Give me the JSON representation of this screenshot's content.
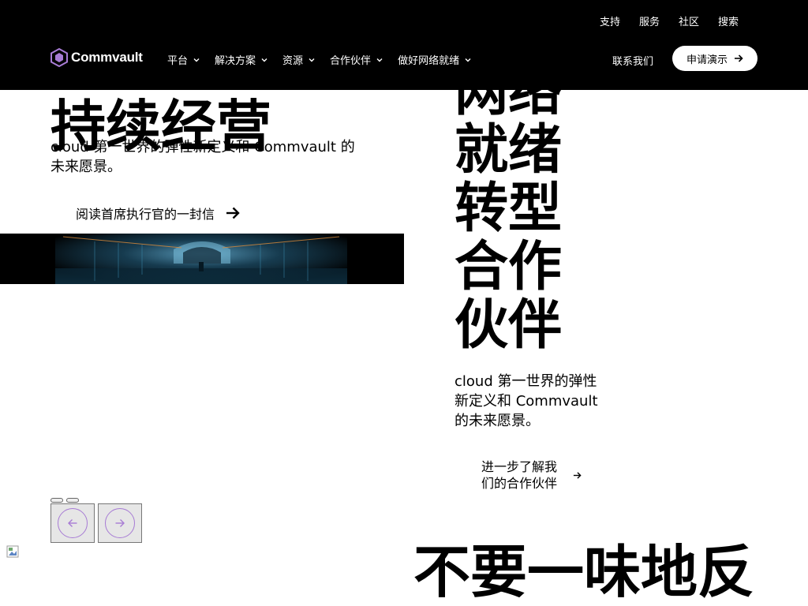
{
  "header": {
    "utility_links": [
      "支持",
      "服务",
      "社区",
      "搜索"
    ],
    "logo_text": "Commvault",
    "nav": [
      "平台",
      "解决方案",
      "资源",
      "合作伙伴",
      "做好网络就绪"
    ],
    "contact_label": "联系我们",
    "demo_label": "申请演示"
  },
  "slide1": {
    "title": "持续经营",
    "description": "cloud 第一世界的弹性新定义和 Commvault 的未来愿景。",
    "cta": "阅读首席执行官的一封信"
  },
  "slide2": {
    "title": "网络就绪转型合作伙伴",
    "description": "cloud 第一世界的弹性新定义和 Commvault 的未来愿景。",
    "cta": "进一步了解我们的合作伙伴"
  },
  "carousel": {
    "dots": 2,
    "prev_icon": "arrow-left-icon",
    "next_icon": "arrow-right-icon"
  },
  "bottom": {
    "headline": "不要一味地反"
  },
  "colors": {
    "header_bg": "#000000",
    "accent": "#a77bd4"
  }
}
